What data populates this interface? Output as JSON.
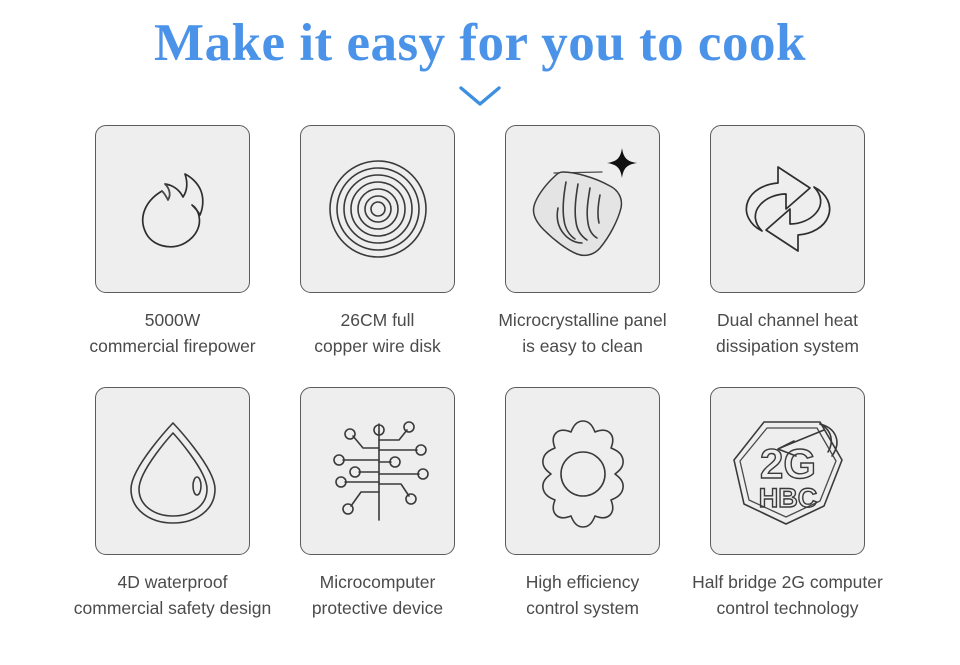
{
  "header": {
    "title": "Make it easy for you to cook",
    "title_color": "#4a93e8",
    "chevron_icon": "chevron-down-icon",
    "chevron_color": "#3d8fe0"
  },
  "theme": {
    "background": "#ffffff",
    "tile_fill": "#eeeeee",
    "tile_border": "#5b5b5b",
    "icon_stroke": "#3a3a3a",
    "caption_color": "#4b4b4b",
    "accent": "#4a93e8"
  },
  "features": [
    {
      "icon": "flame-icon",
      "caption": "5000W\ncommercial firepower",
      "line1": "5000W",
      "line2": "commercial firepower"
    },
    {
      "icon": "coil-rings-icon",
      "caption": "26CM full\ncopper wire disk",
      "line1": "26CM full",
      "line2": "copper wire disk"
    },
    {
      "icon": "hand-wiping-cloth-icon",
      "caption": "Microcrystalline panel\nis easy to clean",
      "line1": "Microcrystalline panel",
      "line2": "is easy to clean"
    },
    {
      "icon": "circulation-arrows-icon",
      "caption": "Dual channel heat\ndissipation system",
      "line1": "Dual channel heat",
      "line2": "dissipation system"
    },
    {
      "icon": "water-drop-icon",
      "caption": "4D waterproof\ncommercial safety design",
      "line1": "4D waterproof",
      "line2": "commercial safety design"
    },
    {
      "icon": "circuit-board-icon",
      "caption": "Microcomputer\nprotective device",
      "line1": "Microcomputer",
      "line2": "protective device"
    },
    {
      "icon": "gear-icon",
      "caption": "High efficiency\ncontrol system",
      "line1": "High efficiency",
      "line2": "control system"
    },
    {
      "icon": "hexagon-2g-hbc-badge-icon",
      "caption": "Half bridge 2G computer\ncontrol technology",
      "line1": "Half bridge 2G computer",
      "line2": "control technology",
      "badge_primary": "2G",
      "badge_secondary": "HBC"
    }
  ]
}
